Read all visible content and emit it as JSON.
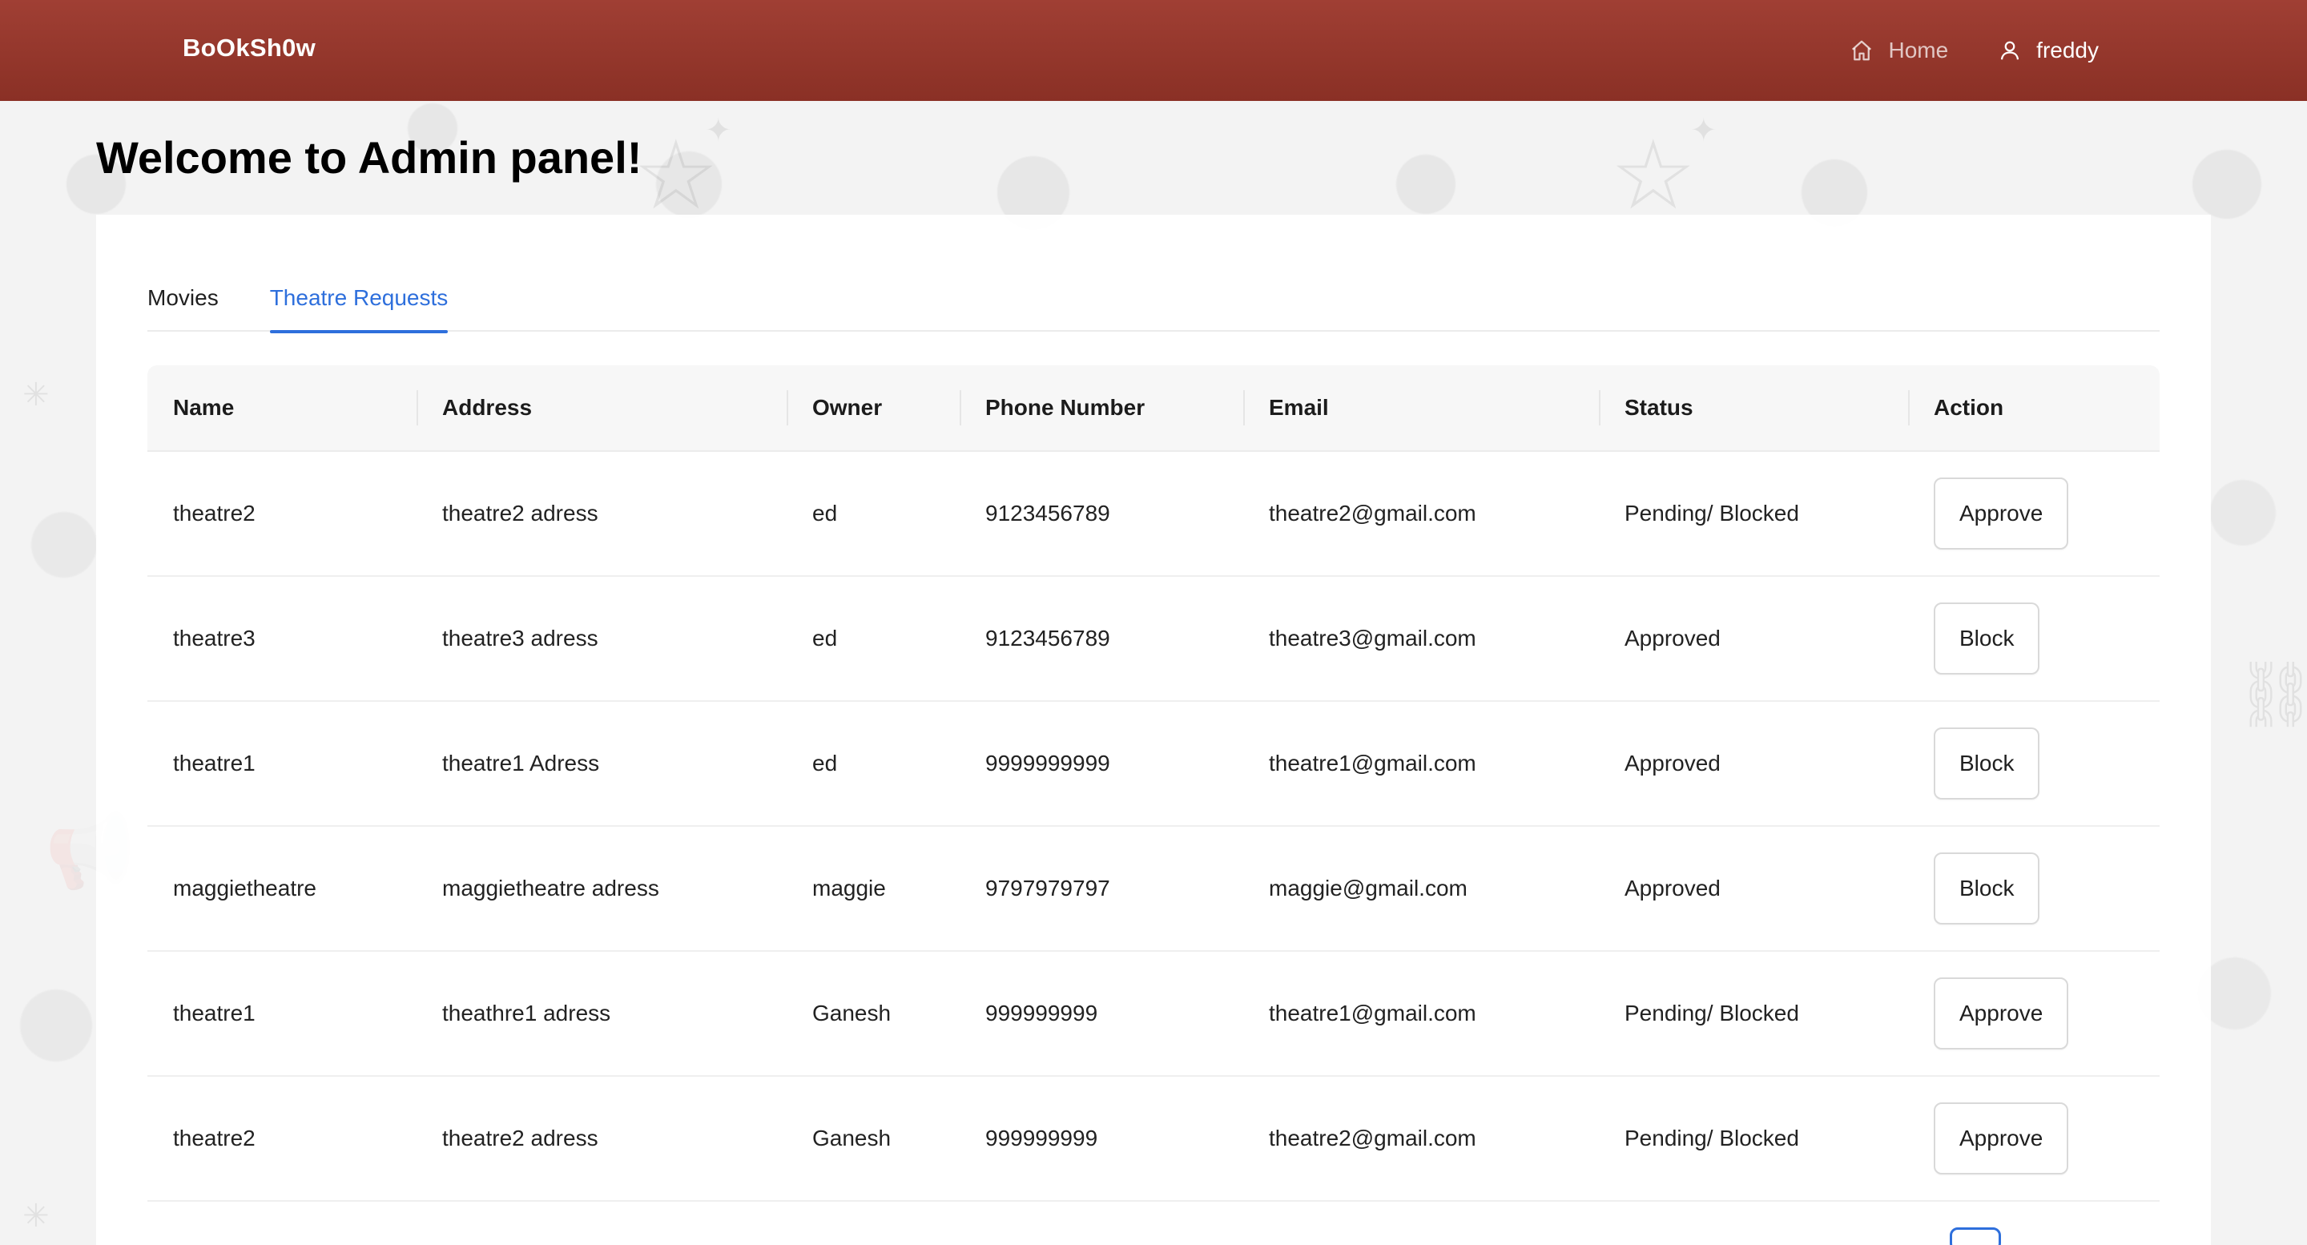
{
  "header": {
    "brand": "BoOkSh0w",
    "nav": {
      "home_label": "Home",
      "home_icon": "home-icon",
      "user_label": "freddy",
      "user_icon": "user-icon"
    },
    "background_color": "#963a2e"
  },
  "page": {
    "title": "Welcome to Admin panel!"
  },
  "tabs": [
    {
      "label": "Movies",
      "active": false
    },
    {
      "label": "Theatre Requests",
      "active": true
    }
  ],
  "accent_color": "#2e6fdc",
  "table": {
    "columns": [
      "Name",
      "Address",
      "Owner",
      "Phone Number",
      "Email",
      "Status",
      "Action"
    ],
    "rows": [
      {
        "name": "theatre2",
        "address": "theatre2 adress",
        "owner": "ed",
        "phone": "9123456789",
        "email": "theatre2@gmail.com",
        "status": "Pending/ Blocked",
        "action": "Approve"
      },
      {
        "name": "theatre3",
        "address": "theatre3 adress",
        "owner": "ed",
        "phone": "9123456789",
        "email": "theatre3@gmail.com",
        "status": "Approved",
        "action": "Block"
      },
      {
        "name": "theatre1",
        "address": "theatre1 Adress",
        "owner": "ed",
        "phone": "9999999999",
        "email": "theatre1@gmail.com",
        "status": "Approved",
        "action": "Block"
      },
      {
        "name": "maggietheatre",
        "address": "maggietheatre adress",
        "owner": "maggie",
        "phone": "9797979797",
        "email": "maggie@gmail.com",
        "status": "Approved",
        "action": "Block"
      },
      {
        "name": "theatre1",
        "address": "theathre1 adress",
        "owner": "Ganesh",
        "phone": "999999999",
        "email": "theatre1@gmail.com",
        "status": "Pending/ Blocked",
        "action": "Approve"
      },
      {
        "name": "theatre2",
        "address": "theatre2 adress",
        "owner": "Ganesh",
        "phone": "999999999",
        "email": "theatre2@gmail.com",
        "status": "Pending/ Blocked",
        "action": "Approve"
      }
    ]
  }
}
